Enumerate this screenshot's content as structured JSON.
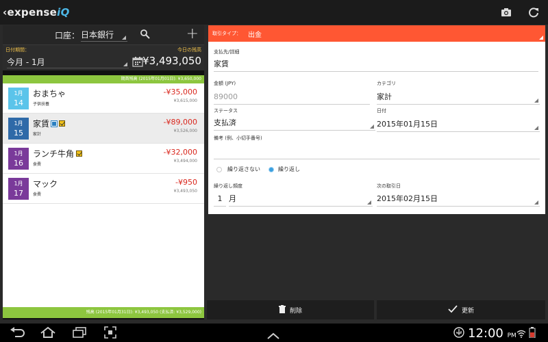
{
  "app": {
    "logo_prefix": "‹expense",
    "logo_suffix": "iQ"
  },
  "account_bar": {
    "label": "口座：",
    "bank": "日本銀行",
    "add_label": "+"
  },
  "period": {
    "label": "日付期間：",
    "value": "今月 - 1月",
    "today_label": "今日の残高",
    "today_balance": "¥3,493,050"
  },
  "opening_balance": "期首残高 (2015年01月01日): ¥3,650,000",
  "closing_balance": "残高 (2015年01月31日): ¥3,493,050 (支払済: ¥3,529,000)",
  "transactions": [
    {
      "month": "1月",
      "day": "14",
      "name": "おまちゃ",
      "category": "子供扶養",
      "amount": "-¥35,000",
      "running": "¥3,615,000",
      "color": "#5bc4ea",
      "badges": []
    },
    {
      "month": "1月",
      "day": "15",
      "name": "家賃",
      "category": "家計",
      "amount": "-¥89,000",
      "running": "¥3,526,000",
      "color": "#2f6aa8",
      "badges": [
        "blue",
        "yellow"
      ]
    },
    {
      "month": "1月",
      "day": "16",
      "name": "ランチ牛角",
      "category": "食費",
      "amount": "-¥32,000",
      "running": "¥3,494,000",
      "color": "#7a3a9a",
      "badges": [
        "yellow"
      ]
    },
    {
      "month": "1月",
      "day": "17",
      "name": "マック",
      "category": "食費",
      "amount": "-¥950",
      "running": "¥3,493,050",
      "color": "#7a3a9a",
      "badges": []
    }
  ],
  "form": {
    "type_label": "取引タイプ：",
    "type_value": "出金",
    "payee_label": "支払先/詳細",
    "payee_value": "家賃",
    "amount_label": "金額 (JPY)",
    "amount_value": "89000",
    "category_label": "カテゴリ",
    "category_value": "家計",
    "status_label": "ステータス",
    "status_value": "支払済",
    "date_label": "日付",
    "date_value": "2015年01月15日",
    "memo_label": "備考 (例、小切手番号)",
    "memo_value": "",
    "repeat_off_label": "繰り返さない",
    "repeat_on_label": "繰り返し",
    "freq_label": "繰り返し頻度",
    "freq_num": "1",
    "freq_unit": "月",
    "next_label": "次の取引日",
    "next_value": "2015年02月15日"
  },
  "buttons": {
    "delete_label": "削除",
    "update_label": "更新"
  },
  "status_bar": {
    "time": "12:00",
    "ampm": "PM"
  },
  "colors": {
    "accent_orange": "#ff5733",
    "green": "#8dc63f",
    "negative": "#d9261c"
  }
}
